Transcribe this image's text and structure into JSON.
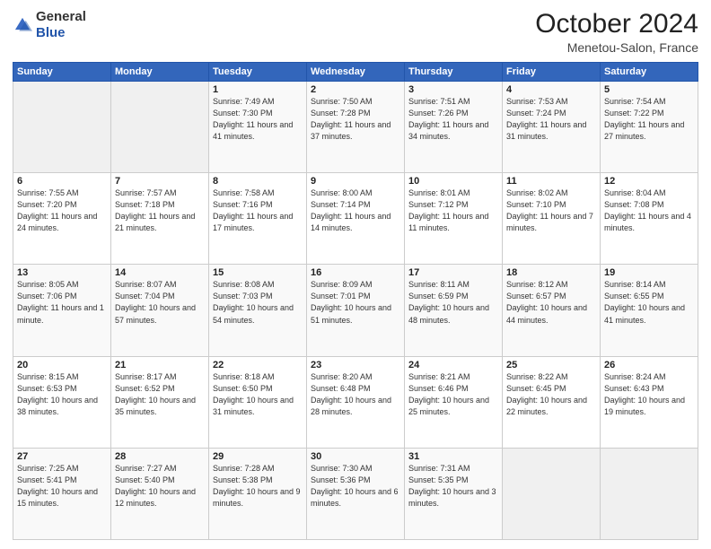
{
  "header": {
    "logo_general": "General",
    "logo_blue": "Blue",
    "month": "October 2024",
    "location": "Menetou-Salon, France"
  },
  "weekdays": [
    "Sunday",
    "Monday",
    "Tuesday",
    "Wednesday",
    "Thursday",
    "Friday",
    "Saturday"
  ],
  "weeks": [
    [
      {
        "day": "",
        "sunrise": "",
        "sunset": "",
        "daylight": ""
      },
      {
        "day": "",
        "sunrise": "",
        "sunset": "",
        "daylight": ""
      },
      {
        "day": "1",
        "sunrise": "Sunrise: 7:49 AM",
        "sunset": "Sunset: 7:30 PM",
        "daylight": "Daylight: 11 hours and 41 minutes."
      },
      {
        "day": "2",
        "sunrise": "Sunrise: 7:50 AM",
        "sunset": "Sunset: 7:28 PM",
        "daylight": "Daylight: 11 hours and 37 minutes."
      },
      {
        "day": "3",
        "sunrise": "Sunrise: 7:51 AM",
        "sunset": "Sunset: 7:26 PM",
        "daylight": "Daylight: 11 hours and 34 minutes."
      },
      {
        "day": "4",
        "sunrise": "Sunrise: 7:53 AM",
        "sunset": "Sunset: 7:24 PM",
        "daylight": "Daylight: 11 hours and 31 minutes."
      },
      {
        "day": "5",
        "sunrise": "Sunrise: 7:54 AM",
        "sunset": "Sunset: 7:22 PM",
        "daylight": "Daylight: 11 hours and 27 minutes."
      }
    ],
    [
      {
        "day": "6",
        "sunrise": "Sunrise: 7:55 AM",
        "sunset": "Sunset: 7:20 PM",
        "daylight": "Daylight: 11 hours and 24 minutes."
      },
      {
        "day": "7",
        "sunrise": "Sunrise: 7:57 AM",
        "sunset": "Sunset: 7:18 PM",
        "daylight": "Daylight: 11 hours and 21 minutes."
      },
      {
        "day": "8",
        "sunrise": "Sunrise: 7:58 AM",
        "sunset": "Sunset: 7:16 PM",
        "daylight": "Daylight: 11 hours and 17 minutes."
      },
      {
        "day": "9",
        "sunrise": "Sunrise: 8:00 AM",
        "sunset": "Sunset: 7:14 PM",
        "daylight": "Daylight: 11 hours and 14 minutes."
      },
      {
        "day": "10",
        "sunrise": "Sunrise: 8:01 AM",
        "sunset": "Sunset: 7:12 PM",
        "daylight": "Daylight: 11 hours and 11 minutes."
      },
      {
        "day": "11",
        "sunrise": "Sunrise: 8:02 AM",
        "sunset": "Sunset: 7:10 PM",
        "daylight": "Daylight: 11 hours and 7 minutes."
      },
      {
        "day": "12",
        "sunrise": "Sunrise: 8:04 AM",
        "sunset": "Sunset: 7:08 PM",
        "daylight": "Daylight: 11 hours and 4 minutes."
      }
    ],
    [
      {
        "day": "13",
        "sunrise": "Sunrise: 8:05 AM",
        "sunset": "Sunset: 7:06 PM",
        "daylight": "Daylight: 11 hours and 1 minute."
      },
      {
        "day": "14",
        "sunrise": "Sunrise: 8:07 AM",
        "sunset": "Sunset: 7:04 PM",
        "daylight": "Daylight: 10 hours and 57 minutes."
      },
      {
        "day": "15",
        "sunrise": "Sunrise: 8:08 AM",
        "sunset": "Sunset: 7:03 PM",
        "daylight": "Daylight: 10 hours and 54 minutes."
      },
      {
        "day": "16",
        "sunrise": "Sunrise: 8:09 AM",
        "sunset": "Sunset: 7:01 PM",
        "daylight": "Daylight: 10 hours and 51 minutes."
      },
      {
        "day": "17",
        "sunrise": "Sunrise: 8:11 AM",
        "sunset": "Sunset: 6:59 PM",
        "daylight": "Daylight: 10 hours and 48 minutes."
      },
      {
        "day": "18",
        "sunrise": "Sunrise: 8:12 AM",
        "sunset": "Sunset: 6:57 PM",
        "daylight": "Daylight: 10 hours and 44 minutes."
      },
      {
        "day": "19",
        "sunrise": "Sunrise: 8:14 AM",
        "sunset": "Sunset: 6:55 PM",
        "daylight": "Daylight: 10 hours and 41 minutes."
      }
    ],
    [
      {
        "day": "20",
        "sunrise": "Sunrise: 8:15 AM",
        "sunset": "Sunset: 6:53 PM",
        "daylight": "Daylight: 10 hours and 38 minutes."
      },
      {
        "day": "21",
        "sunrise": "Sunrise: 8:17 AM",
        "sunset": "Sunset: 6:52 PM",
        "daylight": "Daylight: 10 hours and 35 minutes."
      },
      {
        "day": "22",
        "sunrise": "Sunrise: 8:18 AM",
        "sunset": "Sunset: 6:50 PM",
        "daylight": "Daylight: 10 hours and 31 minutes."
      },
      {
        "day": "23",
        "sunrise": "Sunrise: 8:20 AM",
        "sunset": "Sunset: 6:48 PM",
        "daylight": "Daylight: 10 hours and 28 minutes."
      },
      {
        "day": "24",
        "sunrise": "Sunrise: 8:21 AM",
        "sunset": "Sunset: 6:46 PM",
        "daylight": "Daylight: 10 hours and 25 minutes."
      },
      {
        "day": "25",
        "sunrise": "Sunrise: 8:22 AM",
        "sunset": "Sunset: 6:45 PM",
        "daylight": "Daylight: 10 hours and 22 minutes."
      },
      {
        "day": "26",
        "sunrise": "Sunrise: 8:24 AM",
        "sunset": "Sunset: 6:43 PM",
        "daylight": "Daylight: 10 hours and 19 minutes."
      }
    ],
    [
      {
        "day": "27",
        "sunrise": "Sunrise: 7:25 AM",
        "sunset": "Sunset: 5:41 PM",
        "daylight": "Daylight: 10 hours and 15 minutes."
      },
      {
        "day": "28",
        "sunrise": "Sunrise: 7:27 AM",
        "sunset": "Sunset: 5:40 PM",
        "daylight": "Daylight: 10 hours and 12 minutes."
      },
      {
        "day": "29",
        "sunrise": "Sunrise: 7:28 AM",
        "sunset": "Sunset: 5:38 PM",
        "daylight": "Daylight: 10 hours and 9 minutes."
      },
      {
        "day": "30",
        "sunrise": "Sunrise: 7:30 AM",
        "sunset": "Sunset: 5:36 PM",
        "daylight": "Daylight: 10 hours and 6 minutes."
      },
      {
        "day": "31",
        "sunrise": "Sunrise: 7:31 AM",
        "sunset": "Sunset: 5:35 PM",
        "daylight": "Daylight: 10 hours and 3 minutes."
      },
      {
        "day": "",
        "sunrise": "",
        "sunset": "",
        "daylight": ""
      },
      {
        "day": "",
        "sunrise": "",
        "sunset": "",
        "daylight": ""
      }
    ]
  ]
}
